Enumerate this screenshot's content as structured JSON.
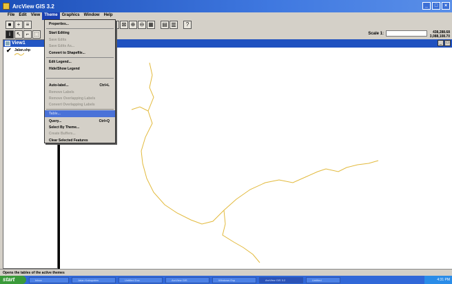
{
  "window": {
    "title": "ArcView GIS 3.2",
    "controls": [
      "_",
      "□",
      "×"
    ]
  },
  "menubar": {
    "items": [
      "File",
      "Edit",
      "View",
      "Theme",
      "Graphics",
      "Window",
      "Help"
    ],
    "active_index": 3
  },
  "toolbar": {
    "scale_label": "Scale 1:",
    "coords_line1": "438,288.68",
    "coords_line2": "3,088,108.70"
  },
  "toc": {
    "view_title": "View1",
    "layers": [
      {
        "name": "Jalan.shp",
        "checked": true,
        "color": "#e2b93b"
      }
    ]
  },
  "theme_menu": {
    "items": [
      {
        "label": "Properties...",
        "shortcut": "",
        "enabled": true
      },
      {
        "label": "Start Editing",
        "shortcut": "",
        "enabled": true
      },
      {
        "label": "Save Edits",
        "shortcut": "",
        "enabled": false
      },
      {
        "label": "Save Edits As...",
        "shortcut": "",
        "enabled": false
      },
      {
        "label": "Convert to Shapefile...",
        "shortcut": "",
        "enabled": true
      },
      {
        "label": "Edit Legend...",
        "shortcut": "",
        "enabled": true
      },
      {
        "label": "Hide/Show Legend",
        "shortcut": "",
        "enabled": true
      },
      {
        "label": "Auto-label...",
        "shortcut": "Ctrl+L",
        "enabled": true
      },
      {
        "label": "Remove Labels",
        "shortcut": "",
        "enabled": false
      },
      {
        "label": "Remove Overlapping Labels",
        "shortcut": "",
        "enabled": false
      },
      {
        "label": "Convert Overlapping Labels",
        "shortcut": "",
        "enabled": false
      },
      {
        "label": "Table...",
        "shortcut": "",
        "enabled": true,
        "selected": true
      },
      {
        "label": "Query...",
        "shortcut": "Ctrl+Q",
        "enabled": true
      },
      {
        "label": "Select By Theme...",
        "shortcut": "",
        "enabled": true
      },
      {
        "label": "Create Buffers...",
        "shortcut": "",
        "enabled": false
      },
      {
        "label": "Clear Selected Features",
        "shortcut": "",
        "enabled": true
      }
    ]
  },
  "statusbar": {
    "text": "Opens the tables of the active themes"
  },
  "taskbar": {
    "start_label": "start",
    "tasks": [
      "Inbox",
      "Jalan Kabupaten",
      "Untitled Doc",
      "ArcView GIS",
      "Windows Exp",
      "ArcView GIS 3.2",
      "Untitled"
    ],
    "tray_time": "4:31 PM"
  },
  "colors": {
    "titlebar": "#1d4fb8",
    "selected_item": "#4a72d8",
    "road_line": "#e2b93b"
  }
}
